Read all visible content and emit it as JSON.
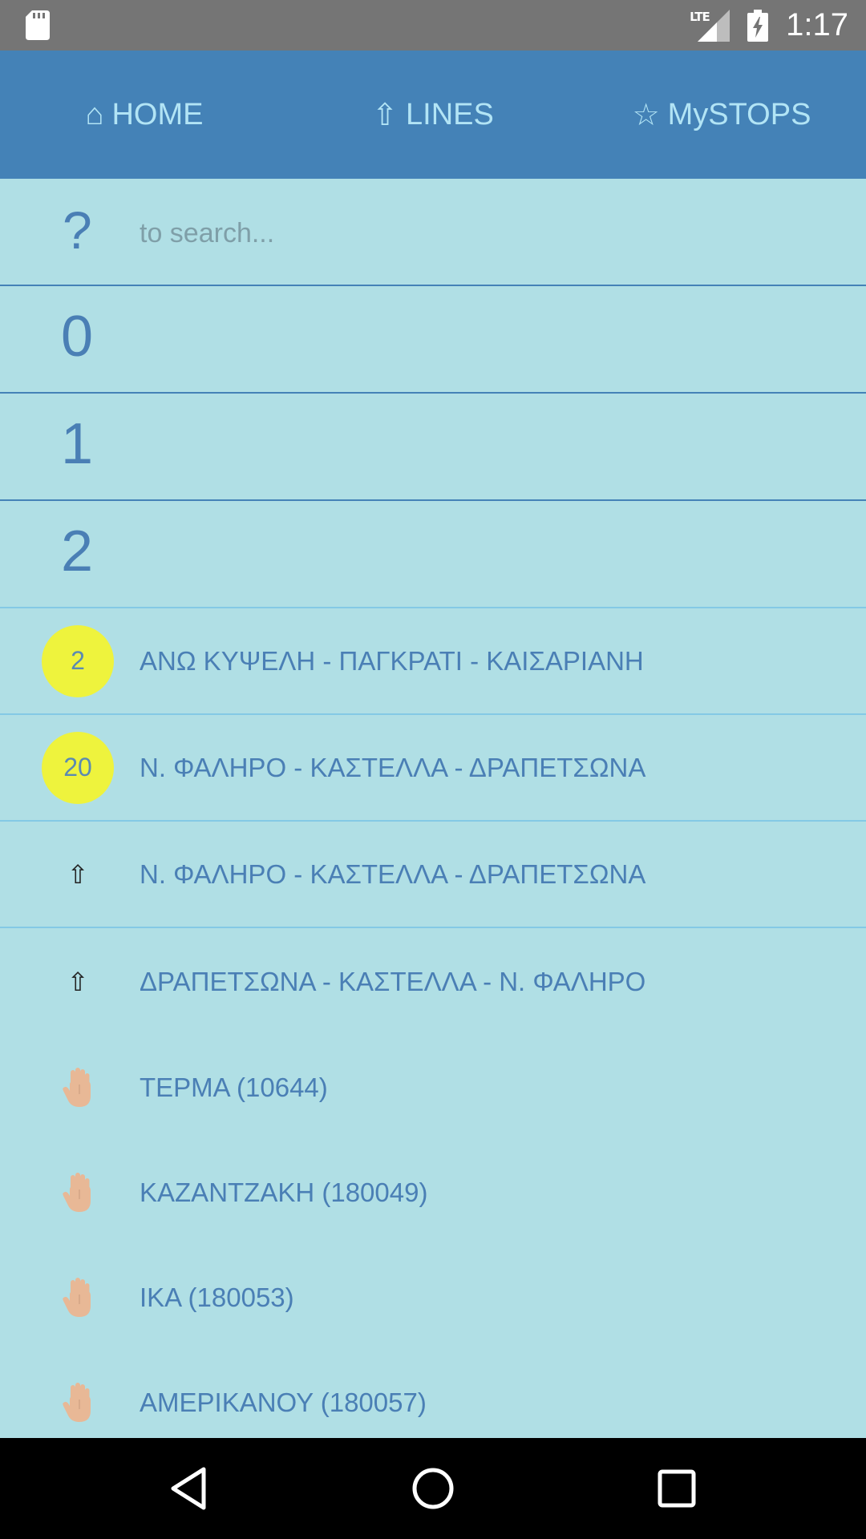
{
  "status_bar": {
    "network": "LTE",
    "time": "1:17"
  },
  "nav": {
    "tabs": [
      {
        "icon": "⌂",
        "icon_name": "home-icon",
        "label": "HOME"
      },
      {
        "icon": "⇧",
        "icon_name": "up-arrow-icon",
        "label": "LINES"
      },
      {
        "icon": "☆",
        "icon_name": "star-icon",
        "label": "MySTOPS"
      }
    ]
  },
  "search": {
    "icon": "?",
    "placeholder": "to search...",
    "value": ""
  },
  "sections": [
    {
      "number": "0"
    },
    {
      "number": "1"
    },
    {
      "number": "2"
    }
  ],
  "lines": [
    {
      "badge": "2",
      "label": "ΑΝΩ ΚΥΨΕΛΗ - ΠΑΓΚΡΑΤΙ - ΚΑΙΣΑΡΙΑΝΗ"
    },
    {
      "badge": "20",
      "label": "Ν. ΦΑΛΗΡΟ - ΚΑΣΤΕΛΛΑ - ΔΡΑΠΕΤΣΩΝΑ"
    }
  ],
  "routes": [
    {
      "icon": "⇧",
      "label": "Ν. ΦΑΛΗΡΟ - ΚΑΣΤΕΛΛΑ - ΔΡΑΠΕΤΣΩΝΑ"
    },
    {
      "icon": "⇧",
      "label": "ΔΡΑΠΕΤΣΩΝΑ - ΚΑΣΤΕΛΛΑ - Ν. ΦΑΛΗΡΟ"
    }
  ],
  "stops": [
    {
      "label": "ΤΕΡΜΑ (10644)"
    },
    {
      "label": "ΚΑΖΑΝΤΖΑΚΗ (180049)"
    },
    {
      "label": "ΙΚΑ (180053)"
    },
    {
      "label": "ΑΜΕΡΙΚΑΝΟΥ (180057)"
    }
  ],
  "colors": {
    "nav_background": "#4482b7",
    "nav_text": "#b2e4f5",
    "content_background": "#b0dfe5",
    "text_primary": "#4a7fb5",
    "badge_yellow": "#eef33d"
  }
}
